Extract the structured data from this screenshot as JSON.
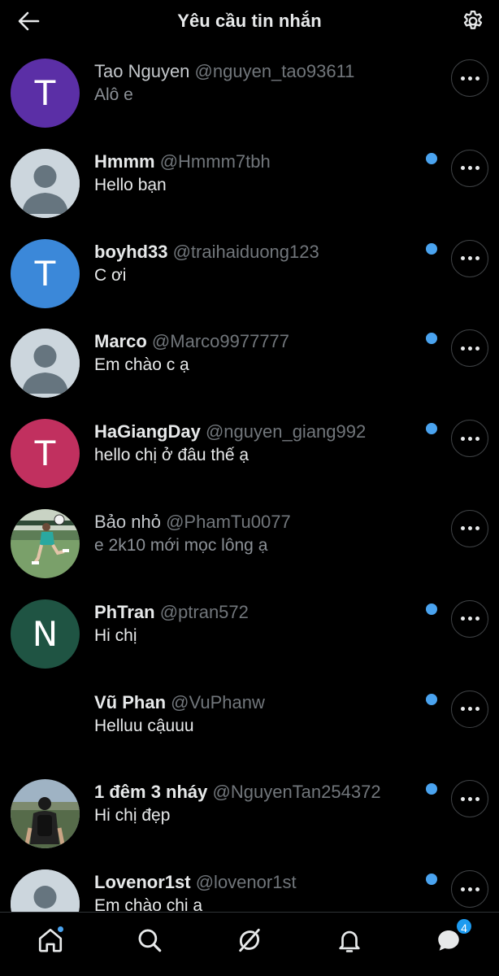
{
  "header": {
    "title": "Yêu cầu tin nhắn",
    "back_icon": "arrow-left-icon",
    "settings_icon": "gear-icon"
  },
  "requests": [
    {
      "name": "Tao Nguyen",
      "handle": "@nguyen_tao93611",
      "message": "Alô e",
      "unread": false,
      "avatar": {
        "type": "letter",
        "letter": "T",
        "color": "#5b2fa6"
      }
    },
    {
      "name": "Hmmm",
      "handle": "@Hmmm7tbh",
      "message": "Hello bạn",
      "unread": true,
      "avatar": {
        "type": "default"
      }
    },
    {
      "name": "boyhd33",
      "handle": "@traihaiduong123",
      "message": "C ơi",
      "unread": true,
      "avatar": {
        "type": "letter",
        "letter": "T",
        "color": "#3b88d9"
      }
    },
    {
      "name": "Marco",
      "handle": "@Marco9977777",
      "message": "Em chào c ạ",
      "unread": true,
      "avatar": {
        "type": "default"
      }
    },
    {
      "name": "HaGiangDay",
      "handle": "@nguyen_giang992",
      "message": "hello chị ở đâu thế ạ",
      "unread": true,
      "avatar": {
        "type": "letter",
        "letter": "T",
        "color": "#c1305f"
      }
    },
    {
      "name": "Bảo nhỏ",
      "handle": "@PhamTu0077",
      "message": "e 2k10 mới mọc lông ạ",
      "unread": false,
      "avatar": {
        "type": "photo",
        "photo": "soccer-photo"
      }
    },
    {
      "name": "PhTran",
      "handle": "@ptran572",
      "message": "Hi chị",
      "unread": true,
      "avatar": {
        "type": "letter",
        "letter": "N",
        "color": "#1f5443"
      }
    },
    {
      "name": "Vũ Phan",
      "handle": "@VuPhanw",
      "message": "Helluu cậuuu",
      "unread": true,
      "avatar": {
        "type": "none"
      }
    },
    {
      "name": "1 đêm 3 nháy",
      "handle": "@NguyenTan254372",
      "message": "Hi chị đẹp",
      "unread": true,
      "avatar": {
        "type": "photo",
        "photo": "backpack-photo"
      }
    },
    {
      "name": "Lovenor1st",
      "handle": "@lovenor1st",
      "message": "Em chào chị a",
      "unread": true,
      "avatar": {
        "type": "default"
      }
    }
  ],
  "tabbar": {
    "items": [
      "home-icon",
      "search-icon",
      "grok-icon",
      "bell-icon",
      "messages-icon"
    ],
    "messages_badge": "4",
    "accent": "#1d9bf0"
  }
}
